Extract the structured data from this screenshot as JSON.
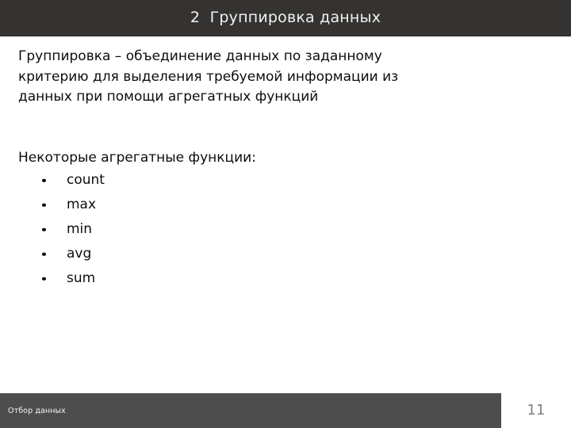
{
  "slide": {
    "header": {
      "number": "2",
      "title": "Группировка данных",
      "full_title": "2  Группировка данных",
      "background_color": "#353331",
      "text_color": "#f2f2f2"
    },
    "body": {
      "definition_paragraph": "Группировка – объединение данных по заданному\nкритерию для выделения требуемой информации из\nданных при помощи агрегатных функций",
      "list_intro": "Некоторые агрегатные функции:",
      "aggregate_functions": [
        "count",
        "max",
        "min",
        "avg",
        "sum"
      ],
      "text_color": "#0d0d0d",
      "background_color": "#ffffff"
    },
    "footer": {
      "section_label": "Отбор данных",
      "page_number": "11",
      "bar_color": "#4d4d4d",
      "label_color": "#f5f5f5",
      "page_number_color": "#7f7f7f"
    }
  }
}
